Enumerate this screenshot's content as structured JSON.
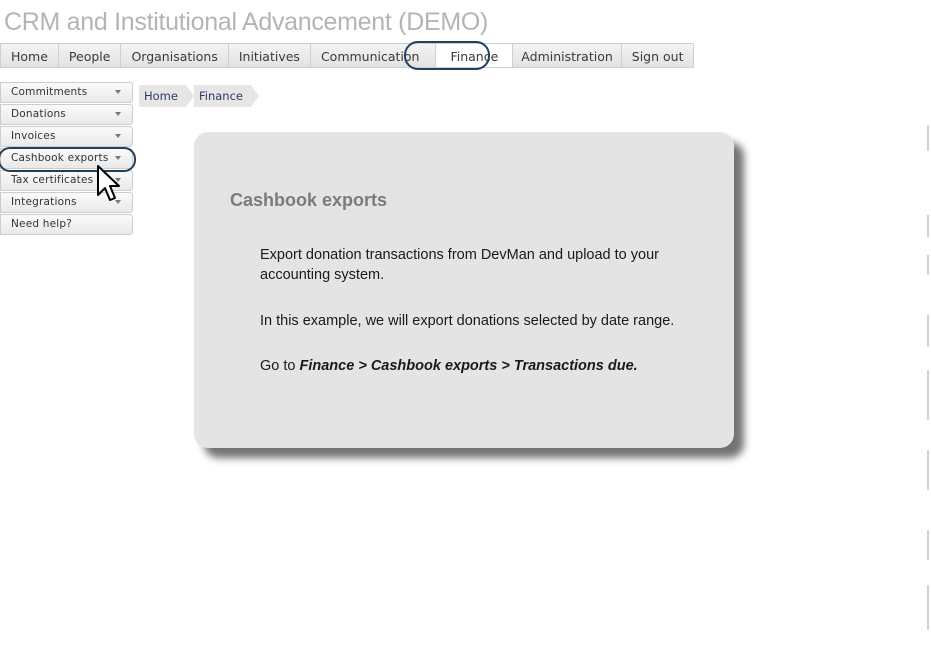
{
  "app": {
    "title": "CRM and Institutional Advancement (DEMO)"
  },
  "topnav": {
    "tabs": [
      {
        "label": "Home"
      },
      {
        "label": "People"
      },
      {
        "label": "Organisations"
      },
      {
        "label": "Initiatives"
      },
      {
        "label": "Communication"
      },
      {
        "label": "Finance",
        "active": true
      },
      {
        "label": "Administration"
      },
      {
        "label": "Sign out"
      }
    ]
  },
  "sidebar": {
    "items": [
      {
        "label": "Commitments",
        "has_dropdown": true
      },
      {
        "label": "Donations",
        "has_dropdown": true
      },
      {
        "label": "Invoices",
        "has_dropdown": true
      },
      {
        "label": "Cashbook exports",
        "has_dropdown": true,
        "highlighted": true
      },
      {
        "label": "Tax certificates",
        "has_dropdown": true
      },
      {
        "label": "Integrations",
        "has_dropdown": true
      },
      {
        "label": "Need help?",
        "has_dropdown": false
      }
    ]
  },
  "breadcrumb": {
    "items": [
      {
        "label": "Home"
      },
      {
        "label": "Finance"
      }
    ]
  },
  "card": {
    "title": "Cashbook exports",
    "paragraph1": "Export donation transactions from DevMan and upload to your accounting system.",
    "paragraph2": "In this example, we will export donations selected by date range.",
    "paragraph3_prefix": "Go to ",
    "paragraph3_path": "Finance > Cashbook exports > Transactions due."
  },
  "colors": {
    "highlight_ring": "#223f5b",
    "card_bg": "#e4e4e4",
    "title_gray": "#b4b4b4",
    "breadcrumb_link": "#2b3a63"
  },
  "icons": [
    "chevron-down-icon",
    "mouse-pointer-icon"
  ]
}
